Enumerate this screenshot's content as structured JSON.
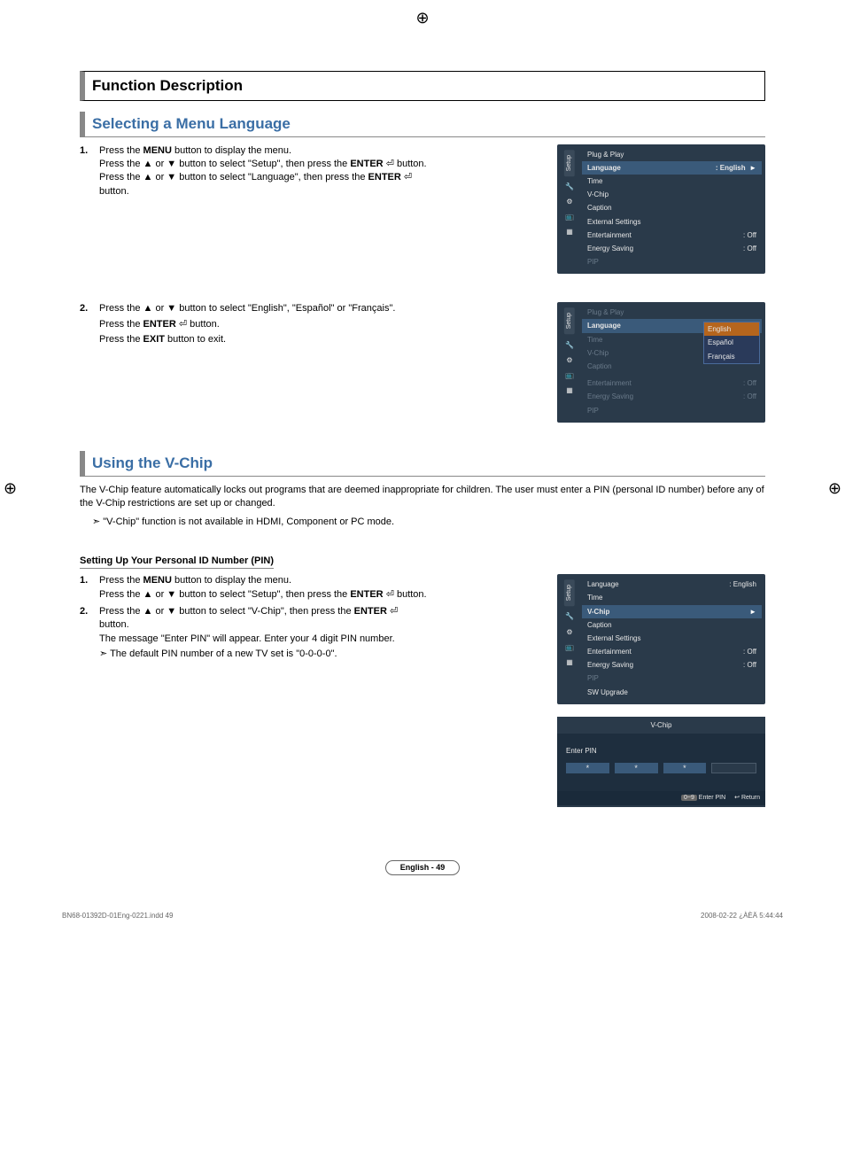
{
  "header": {
    "title": "Function Description"
  },
  "section1": {
    "title": "Selecting a Menu Language",
    "step1_num": "1.",
    "step1_a": "Press the ",
    "step1_menu": "MENU",
    "step1_b": " button to display the menu.",
    "step1_c": "Press the ▲ or ▼ button to select \"Setup\", then press the ",
    "step1_enter": "ENTER",
    "step1_d": " button.",
    "step1_e": "Press the ▲ or ▼ button to select \"Language\", then press the ",
    "step1_f": "button.",
    "step2_num": "2.",
    "step2_a": "Press the ▲ or ▼ button to select \"English\", \"Español\" or \"Français\".",
    "step2_b": "Press the ",
    "step2_c": " button.",
    "step2_d": "Press the ",
    "step2_exit": "EXIT",
    "step2_e": " button to exit."
  },
  "osd1": {
    "tab": "Setup",
    "plug": "Plug & Play",
    "lang": "Language",
    "lang_val": ": English",
    "time": "Time",
    "vchip": "V-Chip",
    "caption": "Caption",
    "ext": "External Settings",
    "ent": "Entertainment",
    "ent_val": ": Off",
    "energy": "Energy Saving",
    "energy_val": ": Off",
    "pip": "PIP",
    "arrow": "►"
  },
  "osd2": {
    "tab": "Setup",
    "plug": "Plug & Play",
    "lang": "Language",
    "time": "Time",
    "vchip": "V-Chip",
    "caption": "Caption",
    "ext": "External Settings",
    "ent": "Entertainment",
    "ent_val": ": Off",
    "energy": "Energy Saving",
    "energy_val": ": Off",
    "pip": "PIP",
    "opt_en": "English",
    "opt_es": "Español",
    "opt_fr": "Français"
  },
  "section2": {
    "title": "Using the V-Chip",
    "para": "The V-Chip feature automatically locks out programs that are deemed inappropriate for children. The user must enter a PIN (personal ID number) before any of the V-Chip restrictions are set up or changed.",
    "note": "\"V-Chip\" function is not available in HDMI, Component or PC mode.",
    "subhead": "Setting Up Your Personal ID Number (PIN)",
    "s1_num": "1.",
    "s1_a": "Press the ",
    "s1_menu": "MENU",
    "s1_b": " button to display the menu.",
    "s1_c": "Press the ▲ or ▼ button to select \"Setup\", then press the ",
    "s1_enter": "ENTER",
    "s1_d": " button.",
    "s2_num": "2.",
    "s2_a": "Press the ▲ or ▼ button to select \"V-Chip\", then press the ",
    "s2_b": "button.",
    "s2_c": "The message \"Enter PIN\" will appear. Enter your 4 digit PIN number.",
    "s2_note": "The default PIN number of a new TV set is \"0-0-0-0\"."
  },
  "osd3": {
    "tab": "Setup",
    "lang": "Language",
    "lang_val": ": English",
    "time": "Time",
    "vchip": "V-Chip",
    "caption": "Caption",
    "ext": "External Settings",
    "ent": "Entertainment",
    "ent_val": ": Off",
    "energy": "Energy Saving",
    "energy_val": ": Off",
    "pip": "PIP",
    "sw": "SW Upgrade",
    "arrow": "►"
  },
  "pin": {
    "title": "V-Chip",
    "label": "Enter PIN",
    "dot": "*",
    "badge": "0~9",
    "enter": "Enter PIN",
    "ret_icon": "↩",
    "ret": "Return"
  },
  "footer": {
    "page": "English - 49"
  },
  "meta": {
    "left": "BN68-01392D-01Eng-0221.indd   49",
    "right": "2008-02-22   ¿ÀÈÄ 5:44:44"
  }
}
